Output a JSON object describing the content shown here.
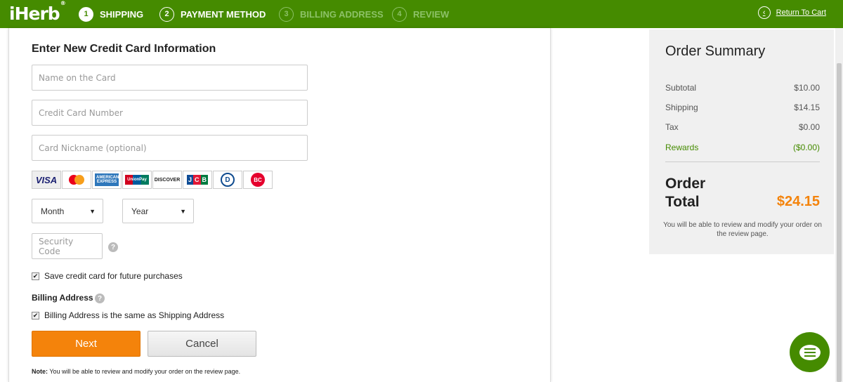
{
  "header": {
    "logo": "iHerb",
    "logo_mark": "®",
    "steps": [
      {
        "num": "1",
        "label": "SHIPPING"
      },
      {
        "num": "2",
        "label": "PAYMENT METHOD"
      },
      {
        "num": "3",
        "label": "BILLING ADDRESS"
      },
      {
        "num": "4",
        "label": "REVIEW"
      }
    ],
    "return_label": "Return To Cart"
  },
  "form": {
    "title": "Enter New Credit Card Information",
    "name_placeholder": "Name on the Card",
    "number_placeholder": "Credit Card Number",
    "nickname_placeholder": "Card Nickname (optional)",
    "card_brands": {
      "visa": "VISA",
      "amex": "AMERICAN EXPRESS",
      "unionpay": "UnionPay",
      "discover": "DISCOVER",
      "jcb": [
        "J",
        "C",
        "B"
      ],
      "diners": "D",
      "bc": "BC"
    },
    "month_label": "Month",
    "year_label": "Year",
    "security_placeholder": "Security Code",
    "save_card_label": "Save credit card for future purchases",
    "billing_label": "Billing Address",
    "billing_same_label": "Billing Address is the same as Shipping Address",
    "next_label": "Next",
    "cancel_label": "Cancel",
    "note_bold": "Note:",
    "note_text": " You will be able to review and modify your order on the review page."
  },
  "summary": {
    "title": "Order Summary",
    "rows": [
      {
        "label": "Subtotal",
        "value": "$10.00"
      },
      {
        "label": "Shipping",
        "value": "$14.15"
      },
      {
        "label": "Tax",
        "value": "$0.00"
      },
      {
        "label": "Rewards",
        "value": "($0.00)"
      }
    ],
    "total_label": "Order Total",
    "total_value": "$24.15",
    "note": "You will be able to review and modify your order on the review page."
  },
  "colors": {
    "brand_green": "#458b00",
    "accent_orange": "#f4830b"
  }
}
